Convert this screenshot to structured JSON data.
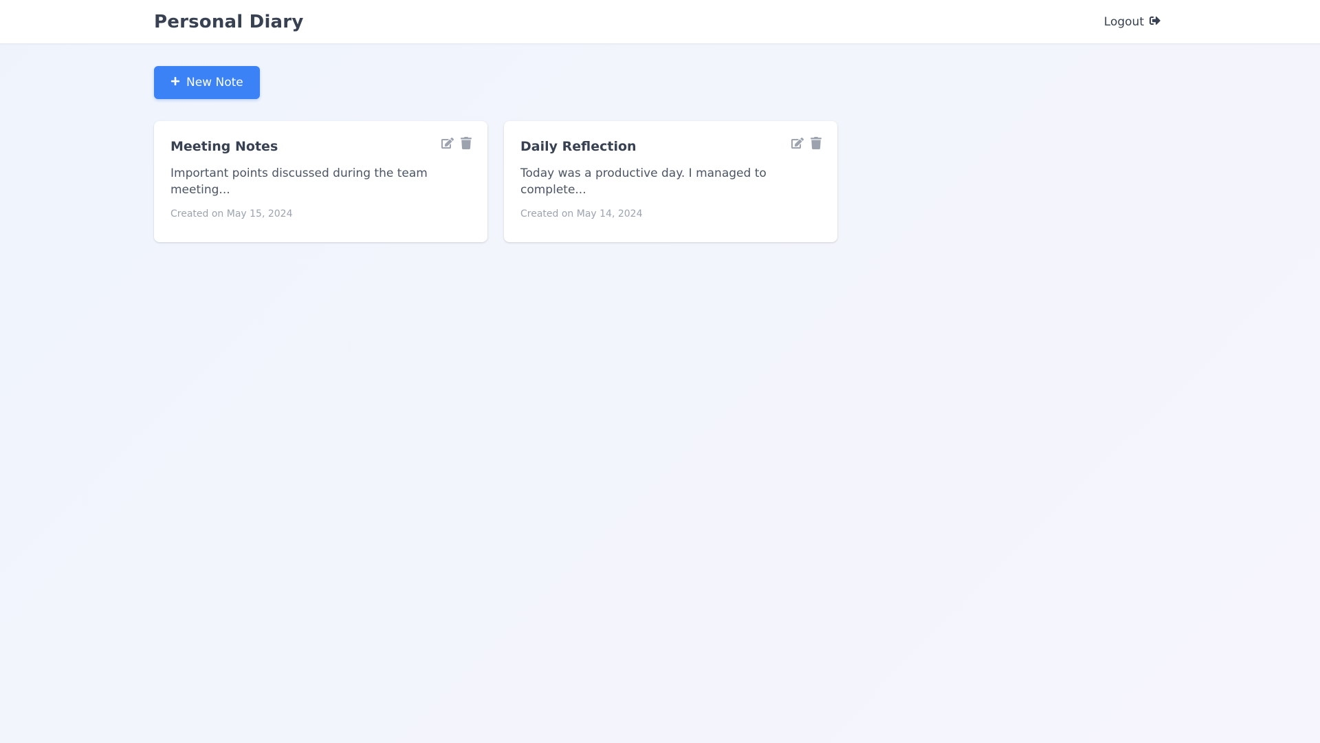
{
  "header": {
    "title": "Personal Diary",
    "logout_label": "Logout",
    "logout_icon": "sign-out-icon"
  },
  "toolbar": {
    "new_note_label": "New Note",
    "new_note_icon": "plus-icon"
  },
  "colors": {
    "primary": "#3b82f6",
    "text": "#374151",
    "muted": "#9ca3af",
    "icon": "#9ca3af"
  },
  "notes": [
    {
      "title": "Meeting Notes",
      "excerpt": "Important points discussed during the team meeting...",
      "created": "Created on May 15, 2024",
      "actions": [
        "edit-icon",
        "trash-icon"
      ]
    },
    {
      "title": "Daily Reflection",
      "excerpt": "Today was a productive day. I managed to complete...",
      "created": "Created on May 14, 2024",
      "actions": [
        "edit-icon",
        "trash-icon"
      ]
    }
  ]
}
